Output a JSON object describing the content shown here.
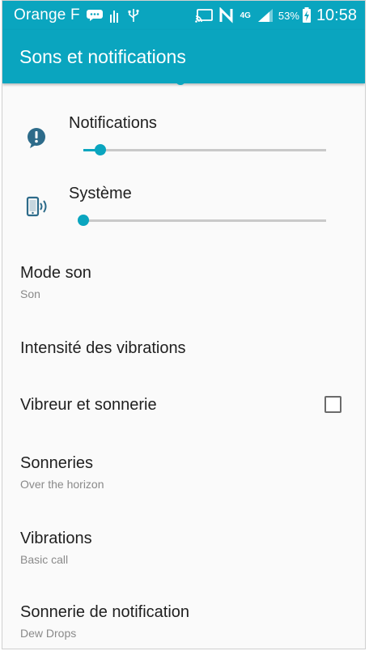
{
  "status_bar": {
    "carrier": "Orange F",
    "network_type": "4G",
    "battery_percent": "53%",
    "time": "10:58",
    "icons": [
      "message-icon",
      "signal-bars-icon",
      "usb-icon",
      "cast-icon",
      "nfc-icon",
      "network-4g-icon",
      "cell-signal-icon",
      "battery-charging-icon"
    ]
  },
  "app_bar": {
    "title": "Sons et notifications"
  },
  "volume": [
    {
      "label": "Notifications",
      "icon": "notification-alert-icon",
      "level": 0.07
    },
    {
      "label": "Système",
      "icon": "phone-sound-icon",
      "level": 0.0
    }
  ],
  "settings": [
    {
      "title": "Mode son",
      "subtitle": "Son"
    },
    {
      "title": "Intensité des vibrations",
      "subtitle": ""
    },
    {
      "title": "Vibreur et sonnerie",
      "subtitle": "",
      "checkbox": false
    },
    {
      "title": "Sonneries",
      "subtitle": "Over the horizon"
    },
    {
      "title": "Vibrations",
      "subtitle": "Basic call"
    },
    {
      "title": "Sonnerie de notification",
      "subtitle": "Dew Drops"
    }
  ],
  "colors": {
    "accent": "#0aa5bf",
    "icon": "#2d6b8a"
  }
}
